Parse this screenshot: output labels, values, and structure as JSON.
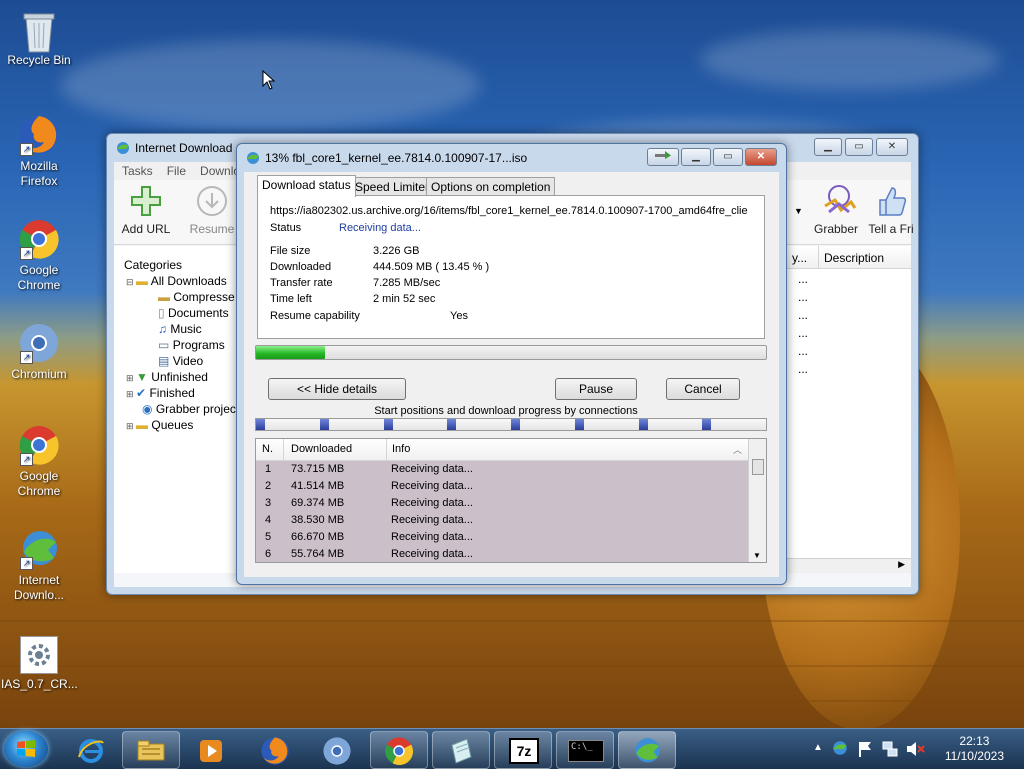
{
  "desktop": {
    "icons": [
      {
        "label": "Recycle Bin",
        "icon": "recycle-bin-icon"
      },
      {
        "label": "Mozilla Firefox",
        "icon": "firefox-icon"
      },
      {
        "label": "Google Chrome",
        "icon": "chrome-icon"
      },
      {
        "label": "Chromium",
        "icon": "chromium-icon"
      },
      {
        "label": "Google Chrome",
        "icon": "chrome-icon"
      },
      {
        "label": "Internet Downlo...",
        "icon": "idm-icon"
      },
      {
        "label": "IAS_0.7_CR...",
        "icon": "settings-file-icon"
      }
    ]
  },
  "main_window": {
    "title": "Internet Download",
    "menu": [
      "Tasks",
      "File",
      "Downlo"
    ],
    "toolbar": {
      "add_url": "Add URL",
      "resume": "Resume",
      "grabber": "Grabber",
      "tell_friend": "Tell a Fri"
    },
    "categories_header": "Categories",
    "categories": [
      {
        "label": "All Downloads"
      },
      {
        "label": "Compresse"
      },
      {
        "label": "Documents"
      },
      {
        "label": "Music"
      },
      {
        "label": "Programs"
      },
      {
        "label": "Video"
      },
      {
        "label": "Unfinished"
      },
      {
        "label": "Finished"
      },
      {
        "label": "Grabber projec"
      },
      {
        "label": "Queues"
      }
    ],
    "list_headers": [
      "y...",
      "Description"
    ],
    "list_rows": [
      "...",
      "...",
      "...",
      "...",
      "...",
      "..."
    ]
  },
  "dialog": {
    "title": "13% fbl_core1_kernel_ee.7814.0.100907-17...iso",
    "tabs": [
      "Download status",
      "Speed Limiter",
      "Options on completion"
    ],
    "url": "https://ia802302.us.archive.org/16/items/fbl_core1_kernel_ee.7814.0.100907-1700_amd64fre_clie",
    "status_label": "Status",
    "status_value": "Receiving data...",
    "file_size_label": "File size",
    "file_size": "3.226  GB",
    "downloaded_label": "Downloaded",
    "downloaded": "444.509  MB  ( 13.45 % )",
    "transfer_rate_label": "Transfer rate",
    "transfer_rate": "7.285  MB/sec",
    "time_left_label": "Time left",
    "time_left": "2 min 52 sec",
    "resume_label": "Resume capability",
    "resume_value": "Yes",
    "progress_fraction": 0.1345,
    "hide_details": "<< Hide details",
    "pause": "Pause",
    "cancel": "Cancel",
    "connections_caption": "Start positions and download progress by connections",
    "connection_starts": [
      0.0,
      0.125,
      0.25,
      0.375,
      0.5,
      0.625,
      0.75,
      0.875
    ],
    "table_headers": [
      "N.",
      "Downloaded",
      "Info"
    ],
    "connections": [
      {
        "n": "1",
        "downloaded": "73.715  MB",
        "info": "Receiving data..."
      },
      {
        "n": "2",
        "downloaded": "41.514  MB",
        "info": "Receiving data..."
      },
      {
        "n": "3",
        "downloaded": "69.374  MB",
        "info": "Receiving data..."
      },
      {
        "n": "4",
        "downloaded": "38.530  MB",
        "info": "Receiving data..."
      },
      {
        "n": "5",
        "downloaded": "66.670  MB",
        "info": "Receiving data..."
      },
      {
        "n": "6",
        "downloaded": "55.764  MB",
        "info": "Receiving data..."
      }
    ]
  },
  "taskbar": {
    "apps": [
      "internet-explorer-icon",
      "file-explorer-icon",
      "media-player-icon",
      "firefox-icon",
      "chromium-icon",
      "chrome-icon",
      "notepad-icon",
      "7zip-icon",
      "cmd-icon",
      "idm-icon"
    ],
    "app_text": {
      "sevenzip": "7z",
      "cmd": "C:\\_"
    },
    "clock_time": "22:13",
    "clock_date": "11/10/2023"
  },
  "colors": {
    "accent": "#1f5fbf",
    "progress": "#22b522",
    "row_highlight": "#cbbfca"
  }
}
